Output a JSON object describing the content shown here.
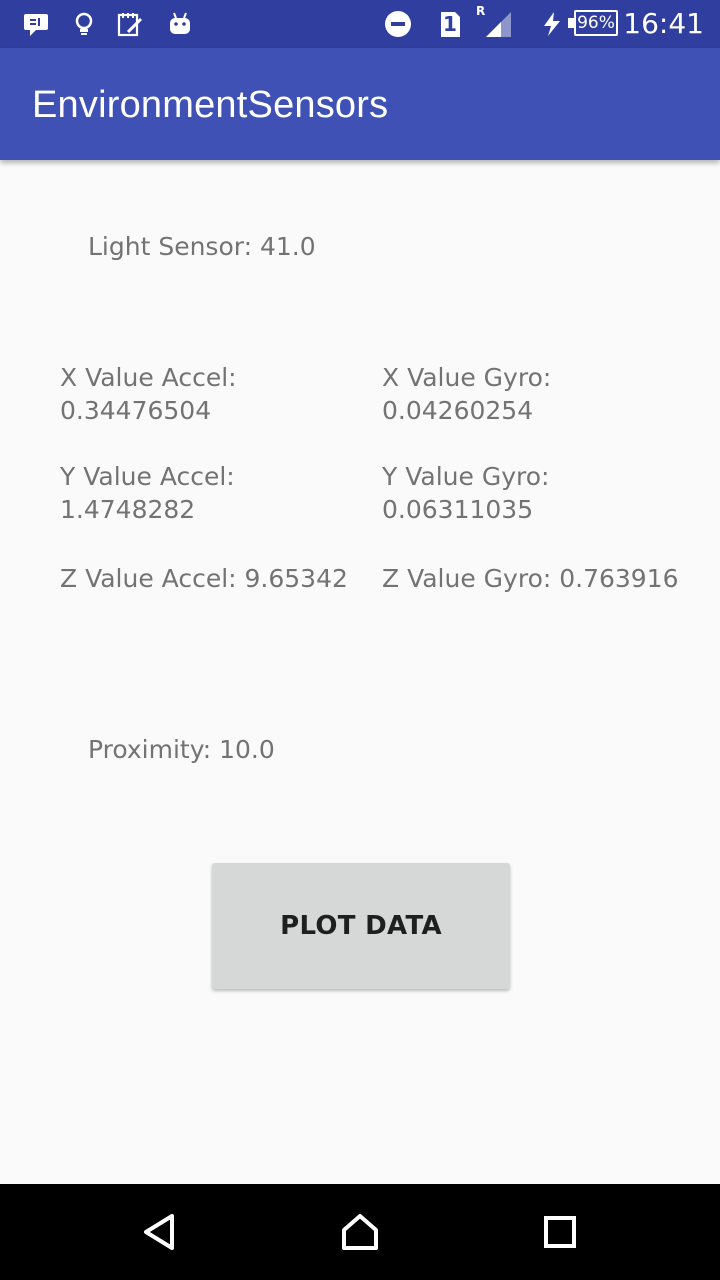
{
  "status_bar": {
    "time": "16:41",
    "battery": "96%",
    "network_label": "R",
    "sim_label": "1",
    "icons": [
      "notification-icon",
      "lightbulb-icon",
      "notes-icon",
      "android-icon",
      "do-not-disturb-icon",
      "sim-icon",
      "signal-icon",
      "charging-icon",
      "battery-icon"
    ]
  },
  "app_bar": {
    "title": "EnvironmentSensors"
  },
  "sensors": {
    "light": "Light Sensor: 41.0",
    "accel_x": "X Value Accel:\n0.34476504",
    "accel_y": "Y Value Accel:\n1.4748282",
    "accel_z": "Z Value Accel: 9.65342",
    "gyro_x": "X Value Gyro:\n0.04260254",
    "gyro_y": "Y Value Gyro:\n0.06311035",
    "gyro_z": "Z Value Gyro: 0.763916",
    "proximity": "Proximity: 10.0"
  },
  "actions": {
    "plot_label": "PLOT DATA"
  },
  "nav_bar": {
    "icons": [
      "back-icon",
      "home-icon",
      "recents-icon"
    ]
  },
  "colors": {
    "status_bar": "#303f9f",
    "app_bar": "#3f51b5",
    "background": "#fafafa",
    "text": "#737373",
    "button": "#d6d7d7"
  }
}
